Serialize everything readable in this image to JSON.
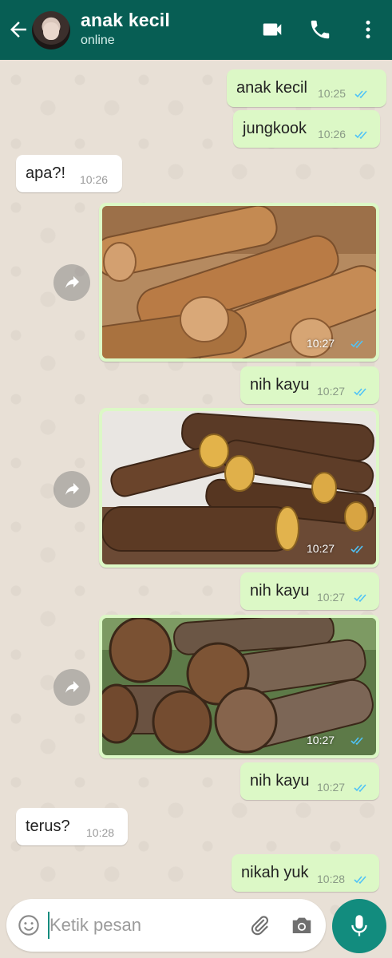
{
  "header": {
    "contact_name": "anak kecil",
    "status": "online",
    "background": "#075e54",
    "icons": [
      "back-arrow-icon",
      "video-call-icon",
      "phone-icon",
      "more-menu-icon"
    ]
  },
  "messages": [
    {
      "type": "text",
      "direction": "out",
      "text": "anak kecil",
      "time": "10:25",
      "read": true
    },
    {
      "type": "text",
      "direction": "out",
      "text": "jungkook",
      "time": "10:26",
      "read": true
    },
    {
      "type": "text",
      "direction": "in",
      "text": "apa?!",
      "time": "10:26"
    },
    {
      "type": "image",
      "direction": "out",
      "time": "10:27",
      "read": true,
      "image": "photo of stacked wooden logs"
    },
    {
      "type": "text",
      "direction": "out",
      "text": "nih kayu",
      "time": "10:27",
      "read": true
    },
    {
      "type": "image",
      "direction": "out",
      "time": "10:27",
      "read": true,
      "image": "photo of licorice root sticks"
    },
    {
      "type": "text",
      "direction": "out",
      "text": "nih kayu",
      "time": "10:27",
      "read": true
    },
    {
      "type": "image",
      "direction": "out",
      "time": "10:27",
      "read": true,
      "image": "photo of cut log ends"
    },
    {
      "type": "text",
      "direction": "out",
      "text": "nih kayu",
      "time": "10:27",
      "read": true
    },
    {
      "type": "text",
      "direction": "in",
      "text": "terus?",
      "time": "10:28"
    },
    {
      "type": "text",
      "direction": "out",
      "text": "nikah yuk",
      "time": "10:28",
      "read": true
    }
  ],
  "composer": {
    "placeholder": "Ketik pesan",
    "icons": [
      "emoji-icon",
      "attach-icon",
      "camera-icon",
      "mic-icon"
    ]
  },
  "colors": {
    "outgoing_bubble": "#dcf8c6",
    "incoming_bubble": "#ffffff",
    "read_tick": "#4fc3f7",
    "accent": "#128c7e"
  }
}
